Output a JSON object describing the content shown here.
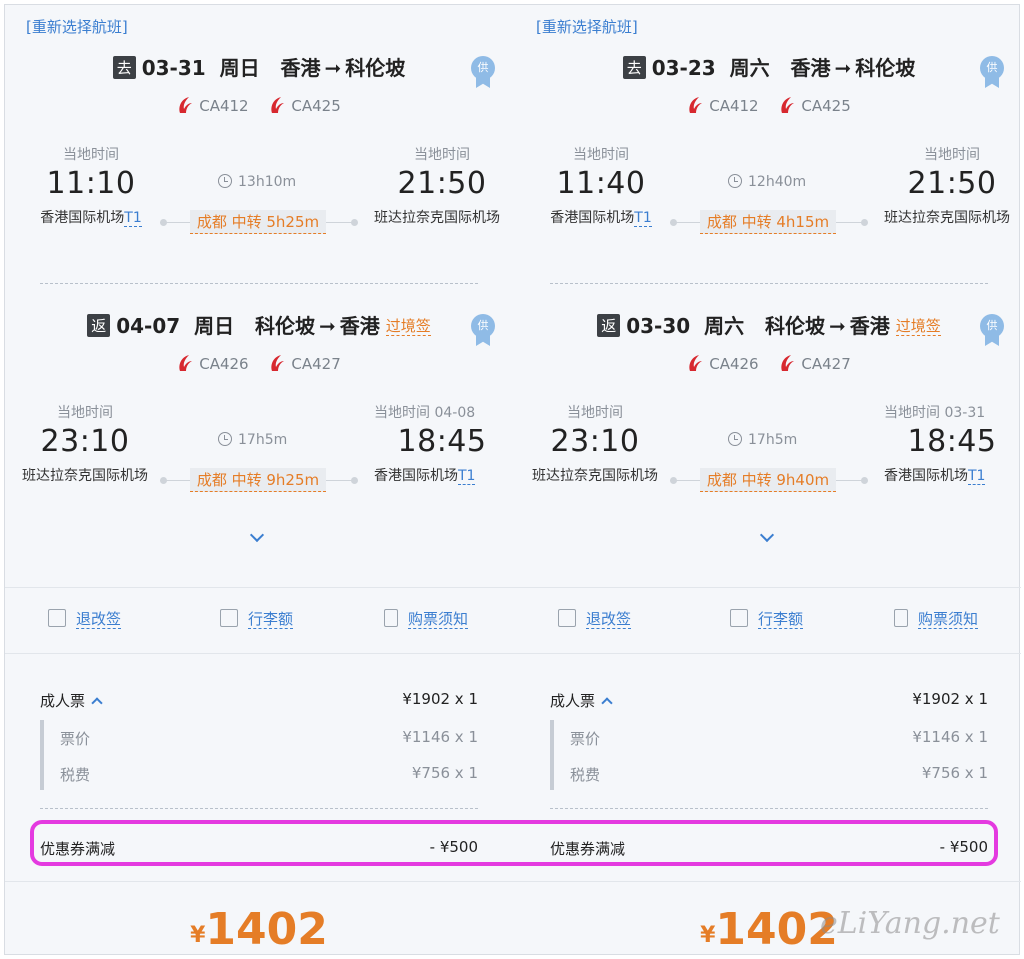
{
  "reselect_label": "[重新选择航班]",
  "colors": {
    "accent_blue": "#3b7ed0",
    "accent_orange": "#e57d27",
    "highlight": "#e43ae0"
  },
  "options": [
    {
      "outbound": {
        "badge": "去",
        "date": "03-31",
        "weekday": "周日",
        "from_city": "香港",
        "to_city": "科伦坡",
        "flights": [
          "CA412",
          "CA425"
        ],
        "dep_label": "当地时间",
        "dep_time": "11:10",
        "dep_airport": "香港国际机场",
        "dep_terminal": "T1",
        "duration": "13h10m",
        "transfer": "成都 中转 5h25m",
        "arr_label": "当地时间",
        "arr_time": "21:50",
        "arr_airport": "班达拉奈克国际机场",
        "arr_terminal": ""
      },
      "return": {
        "badge": "返",
        "date": "04-07",
        "weekday": "周日",
        "from_city": "科伦坡",
        "to_city": "香港",
        "visa": "过境签",
        "flights": [
          "CA426",
          "CA427"
        ],
        "dep_label": "当地时间",
        "dep_time": "23:10",
        "dep_airport": "班达拉奈克国际机场",
        "dep_terminal": "",
        "duration": "17h5m",
        "transfer": "成都 中转 9h25m",
        "arr_label": "当地时间 04-08",
        "arr_time": "18:45",
        "arr_airport": "香港国际机场",
        "arr_terminal": "T1"
      },
      "links": {
        "change": "退改签",
        "baggage": "行李额",
        "notice": "购票须知"
      },
      "fare": {
        "adult_label": "成人票",
        "adult_value": "¥1902 x 1",
        "ticket_label": "票价",
        "ticket_value": "¥1146 x 1",
        "tax_label": "税费",
        "tax_value": "¥756 x 1"
      },
      "coupon": {
        "label": "优惠券满减",
        "value": "- ¥500"
      },
      "total": {
        "currency": "¥",
        "amount": "1402"
      }
    },
    {
      "outbound": {
        "badge": "去",
        "date": "03-23",
        "weekday": "周六",
        "from_city": "香港",
        "to_city": "科伦坡",
        "flights": [
          "CA412",
          "CA425"
        ],
        "dep_label": "当地时间",
        "dep_time": "11:40",
        "dep_airport": "香港国际机场",
        "dep_terminal": "T1",
        "duration": "12h40m",
        "transfer": "成都 中转 4h15m",
        "arr_label": "当地时间",
        "arr_time": "21:50",
        "arr_airport": "班达拉奈克国际机场",
        "arr_terminal": ""
      },
      "return": {
        "badge": "返",
        "date": "03-30",
        "weekday": "周六",
        "from_city": "科伦坡",
        "to_city": "香港",
        "visa": "过境签",
        "flights": [
          "CA426",
          "CA427"
        ],
        "dep_label": "当地时间",
        "dep_time": "23:10",
        "dep_airport": "班达拉奈克国际机场",
        "dep_terminal": "",
        "duration": "17h5m",
        "transfer": "成都 中转 9h40m",
        "arr_label": "当地时间 03-31",
        "arr_time": "18:45",
        "arr_airport": "香港国际机场",
        "arr_terminal": "T1"
      },
      "links": {
        "change": "退改签",
        "baggage": "行李额",
        "notice": "购票须知"
      },
      "fare": {
        "adult_label": "成人票",
        "adult_value": "¥1902 x 1",
        "ticket_label": "票价",
        "ticket_value": "¥1146 x 1",
        "tax_label": "税费",
        "tax_value": "¥756 x 1"
      },
      "coupon": {
        "label": "优惠券满减",
        "value": "- ¥500"
      },
      "total": {
        "currency": "¥",
        "amount": "1402"
      }
    }
  ],
  "supplier_badge": "供",
  "arrow": "➞",
  "watermark": "eLiYang.net"
}
